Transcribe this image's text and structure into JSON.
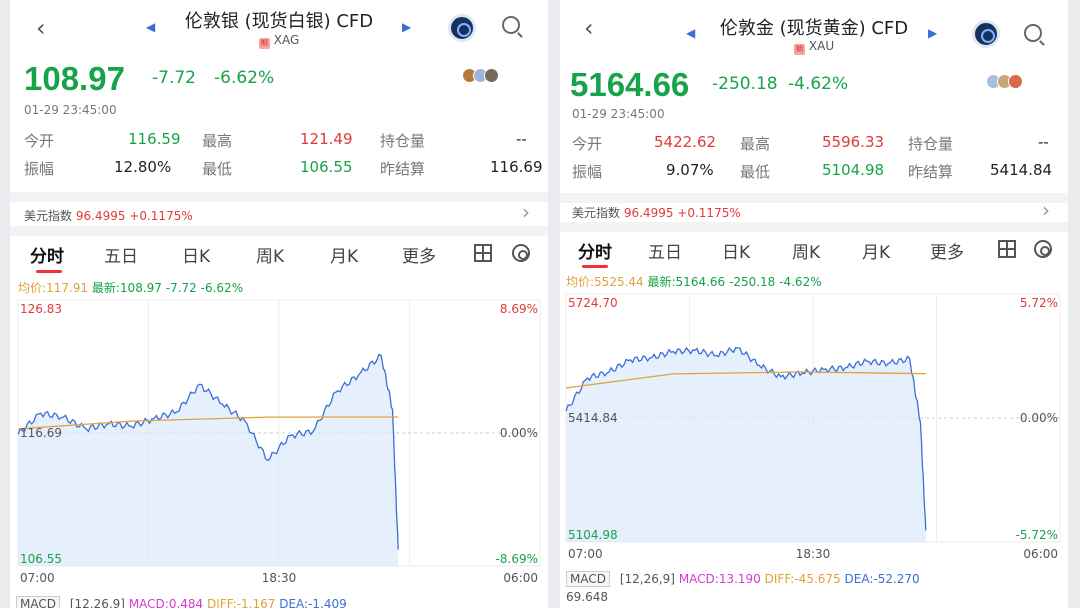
{
  "left": {
    "title": "伦敦银 (现货白银) CFD",
    "code": "XAG",
    "tag": "期",
    "price": "108.97",
    "change": "-7.72",
    "change_pct": "-6.62%",
    "datetime": "01-29 23:45:00",
    "stats": {
      "open_label": "今开",
      "open": "116.59",
      "high_label": "最高",
      "high": "121.49",
      "oi_label": "持仓量",
      "oi": "--",
      "amp_label": "振幅",
      "amp": "12.80%",
      "low_label": "最低",
      "low": "106.55",
      "prev_label": "昨结算",
      "prev": "116.69"
    },
    "usd_label": "美元指数",
    "usd_value": "96.4995",
    "usd_change": "+0.1175%",
    "tabs": [
      "分时",
      "五日",
      "日K",
      "周K",
      "月K",
      "更多"
    ],
    "avg_label": "均价:117.91",
    "latest_label": "最新:108.97",
    "latest_change": "-7.72",
    "latest_pct": "-6.62%",
    "y_top": "126.83",
    "y_mid": "116.69",
    "y_bot": "106.55",
    "pct_top": "8.69%",
    "pct_mid": "0.00%",
    "pct_bot": "-8.69%",
    "x_start": "07:00",
    "x_mid": "18:30",
    "x_end": "06:00",
    "macd_btn": "MACD",
    "macd_params": "[12,26,9]",
    "macd": "MACD:0.484",
    "diff": "DIFF:-1.167",
    "dea": "DEA:-1.409"
  },
  "right": {
    "title": "伦敦金 (现货黄金) CFD",
    "code": "XAU",
    "tag": "期",
    "price": "5164.66",
    "change": "-250.18",
    "change_pct": "-4.62%",
    "datetime": "01-29 23:45:00",
    "stats": {
      "open_label": "今开",
      "open": "5422.62",
      "high_label": "最高",
      "high": "5596.33",
      "oi_label": "持仓量",
      "oi": "--",
      "amp_label": "振幅",
      "amp": "9.07%",
      "low_label": "最低",
      "low": "5104.98",
      "prev_label": "昨结算",
      "prev": "5414.84"
    },
    "usd_label": "美元指数",
    "usd_value": "96.4995",
    "usd_change": "+0.1175%",
    "tabs": [
      "分时",
      "五日",
      "日K",
      "周K",
      "月K",
      "更多"
    ],
    "avg_label": "均价:5525.44",
    "latest_label": "最新:5164.66",
    "latest_change": "-250.18",
    "latest_pct": "-4.62%",
    "y_top": "5724.70",
    "y_mid": "5414.84",
    "y_bot": "5104.98",
    "pct_top": "5.72%",
    "pct_mid": "0.00%",
    "pct_bot": "-5.72%",
    "x_start": "07:00",
    "x_mid": "18:30",
    "x_end": "06:00",
    "macd_btn": "MACD",
    "macd_params": "[12,26,9]",
    "macd": "MACD:13.190",
    "diff": "DIFF:-45.675",
    "dea": "DEA:-52.270",
    "macd_axis": "69.648"
  },
  "colors": {
    "up": "#e03a3a",
    "down": "#17a34a",
    "price_line": "#3b6fd8",
    "avg_line": "#e0a23a",
    "fill": "#dce8fb"
  },
  "chart_data": [
    {
      "type": "line",
      "title": "伦敦银 (现货白银) CFD",
      "xlabel": "",
      "ylabel": "",
      "x_ticks": [
        "07:00",
        "18:30",
        "06:00"
      ],
      "ylim": [
        106.55,
        126.83
      ],
      "reference": 116.69,
      "series": [
        {
          "name": "最新",
          "x": [
            "07:00",
            "08:00",
            "09:00",
            "10:00",
            "11:00",
            "12:00",
            "13:00",
            "14:00",
            "15:00",
            "16:00",
            "17:00",
            "18:00",
            "19:00",
            "20:00",
            "21:00",
            "22:00",
            "23:00",
            "23:30",
            "23:45"
          ],
          "values": [
            116.6,
            118.2,
            117.9,
            117.0,
            117.4,
            117.2,
            117.8,
            118.3,
            120.4,
            118.9,
            117.6,
            114.6,
            116.5,
            116.8,
            119.8,
            121.1,
            122.6,
            118.5,
            107.8
          ]
        },
        {
          "name": "均价",
          "x": [
            "07:00",
            "12:00",
            "18:00",
            "23:45"
          ],
          "values": [
            117.0,
            117.6,
            117.9,
            117.91
          ]
        }
      ],
      "grid": true
    },
    {
      "type": "line",
      "title": "伦敦金 (现货黄金) CFD",
      "xlabel": "",
      "ylabel": "",
      "x_ticks": [
        "07:00",
        "18:30",
        "06:00"
      ],
      "ylim": [
        5104.98,
        5724.7
      ],
      "reference": 5414.84,
      "series": [
        {
          "name": "最新",
          "x": [
            "07:00",
            "08:00",
            "09:00",
            "10:00",
            "11:00",
            "12:00",
            "13:00",
            "14:00",
            "15:00",
            "16:00",
            "17:00",
            "18:00",
            "19:00",
            "20:00",
            "21:00",
            "22:00",
            "23:00",
            "23:30",
            "23:45"
          ],
          "values": [
            5432,
            5515,
            5530,
            5560,
            5566,
            5581,
            5584,
            5571,
            5590,
            5546,
            5518,
            5527,
            5536,
            5540,
            5557,
            5551,
            5563,
            5405,
            5134
          ]
        },
        {
          "name": "均价",
          "x": [
            "07:00",
            "12:00",
            "18:00",
            "23:45"
          ],
          "values": [
            5490,
            5525,
            5530,
            5525.44
          ]
        }
      ],
      "grid": true
    }
  ]
}
